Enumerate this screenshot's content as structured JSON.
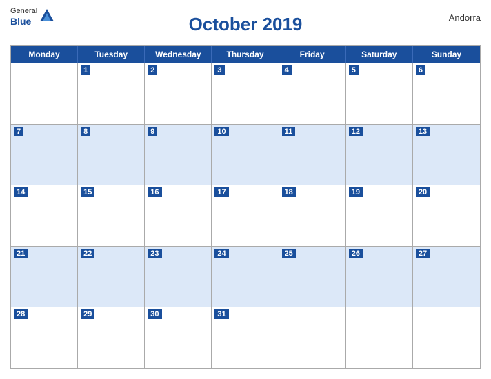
{
  "header": {
    "logo_general": "General",
    "logo_blue": "Blue",
    "title": "October 2019",
    "country": "Andorra"
  },
  "days_of_week": [
    "Monday",
    "Tuesday",
    "Wednesday",
    "Thursday",
    "Friday",
    "Saturday",
    "Sunday"
  ],
  "weeks": [
    [
      {
        "num": "",
        "empty": true
      },
      {
        "num": "1"
      },
      {
        "num": "2"
      },
      {
        "num": "3"
      },
      {
        "num": "4"
      },
      {
        "num": "5"
      },
      {
        "num": "6"
      }
    ],
    [
      {
        "num": "7"
      },
      {
        "num": "8"
      },
      {
        "num": "9"
      },
      {
        "num": "10"
      },
      {
        "num": "11"
      },
      {
        "num": "12"
      },
      {
        "num": "13"
      }
    ],
    [
      {
        "num": "14"
      },
      {
        "num": "15"
      },
      {
        "num": "16"
      },
      {
        "num": "17"
      },
      {
        "num": "18"
      },
      {
        "num": "19"
      },
      {
        "num": "20"
      }
    ],
    [
      {
        "num": "21"
      },
      {
        "num": "22"
      },
      {
        "num": "23"
      },
      {
        "num": "24"
      },
      {
        "num": "25"
      },
      {
        "num": "26"
      },
      {
        "num": "27"
      }
    ],
    [
      {
        "num": "28"
      },
      {
        "num": "29"
      },
      {
        "num": "30"
      },
      {
        "num": "31"
      },
      {
        "num": "",
        "empty": true
      },
      {
        "num": "",
        "empty": true
      },
      {
        "num": "",
        "empty": true
      }
    ]
  ],
  "accent_color": "#1a4f9c",
  "alt_row_color": "#dce8f8"
}
